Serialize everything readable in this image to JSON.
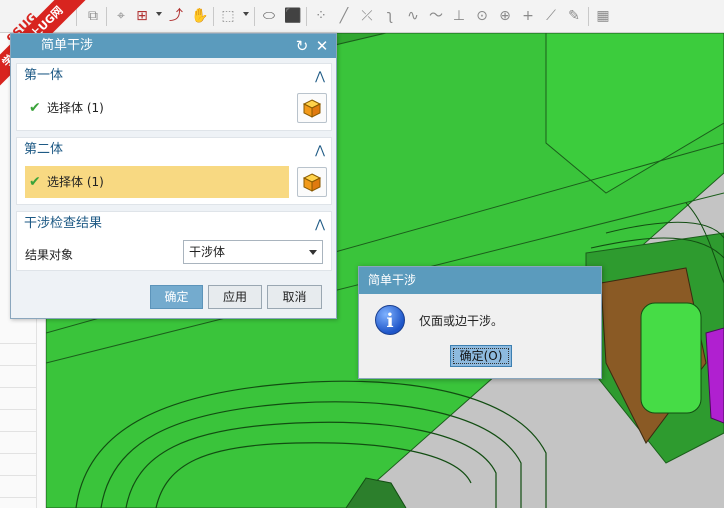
{
  "watermark": {
    "brand": "9SUG",
    "ribbon": "学UG就上UG网"
  },
  "toolbar": {
    "icons": [
      "pointer-icon",
      "copy-icon",
      "snap-icon",
      "point-select-icon",
      "route-icon",
      "hand-icon",
      "box-select-icon",
      "shaded-solid-icon",
      "cube-icon",
      "point-cloud-icon",
      "line-icon",
      "cross-line-icon",
      "curve-icon",
      "spline-icon",
      "wave-icon",
      "tangent-icon",
      "circle-point-icon",
      "center-icon",
      "plus-icon",
      "slash-icon",
      "edit-icon",
      "grid-icon"
    ]
  },
  "dialog": {
    "title": "简单干涉",
    "section1": {
      "title": "第一体",
      "select_label": "选择体 (1)"
    },
    "section2": {
      "title": "第二体",
      "select_label": "选择体 (1)"
    },
    "section3": {
      "title": "干涉检查结果",
      "field_label": "结果对象",
      "field_value": "干涉体"
    },
    "ok_label": "确定",
    "apply_label": "应用",
    "cancel_label": "取消"
  },
  "message": {
    "title": "简单干涉",
    "text": "仅面或边干涉。",
    "ok_label": "确定(O)"
  },
  "colors": {
    "title_bar": "#5b9bbd",
    "model_green": "#39c83a",
    "active_row": "#f8d982",
    "section_header": "#1e5a85"
  }
}
